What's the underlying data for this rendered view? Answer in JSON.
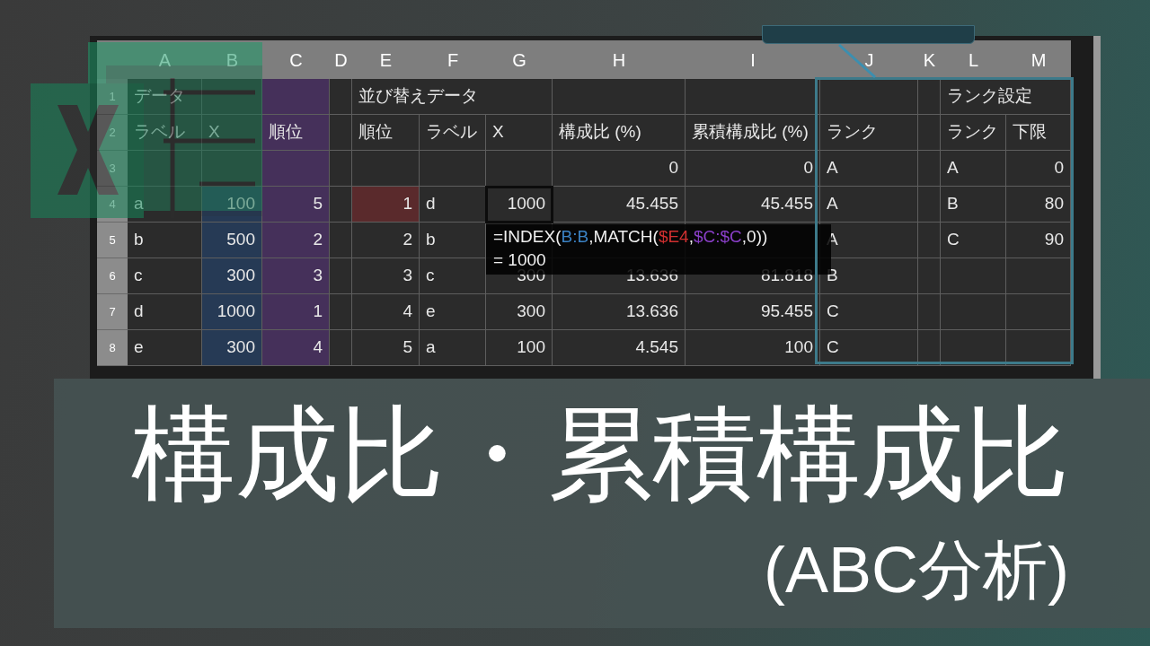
{
  "sheet": {
    "columns": [
      "A",
      "B",
      "C",
      "D",
      "E",
      "F",
      "G",
      "H",
      "I",
      "J",
      "K",
      "L",
      "M"
    ],
    "rows": [
      {
        "header": "1",
        "cells": [
          {
            "kind": "text",
            "text": "データ",
            "selected": false
          },
          {
            "kind": "empty",
            "selected": false
          },
          {
            "kind": "empty",
            "color": "#45305a",
            "selected": false
          },
          {
            "kind": "empty",
            "selected": false
          },
          {
            "kind": "heading",
            "text": "並び替えデータ",
            "selected": false
          },
          {
            "kind": "covered"
          },
          {
            "kind": "covered"
          },
          {
            "kind": "empty",
            "selected": false
          },
          {
            "kind": "empty",
            "selected": false
          },
          {
            "kind": "empty",
            "selected": false
          },
          {
            "kind": "empty",
            "selected": false
          },
          {
            "kind": "heading",
            "text": "ランク設定",
            "selected": false
          },
          {
            "kind": "covered"
          }
        ]
      },
      {
        "header": "2",
        "cells": [
          {
            "kind": "text",
            "text": "ラベル",
            "selected": false
          },
          {
            "kind": "text",
            "text": "X",
            "selected": false
          },
          {
            "kind": "text",
            "text": "順位",
            "color": "#45305a",
            "selected": false
          },
          {
            "kind": "empty",
            "selected": false
          },
          {
            "kind": "text",
            "text": "順位",
            "selected": false
          },
          {
            "kind": "text",
            "text": "ラベル",
            "selected": false
          },
          {
            "kind": "text",
            "text": "X",
            "selected": false
          },
          {
            "kind": "text",
            "text": "構成比 (%)",
            "selected": false
          },
          {
            "kind": "text",
            "text": "累積構成比 (%)",
            "selected": false
          },
          {
            "kind": "text",
            "text": "ランク",
            "selected": false
          },
          {
            "kind": "empty",
            "selected": false
          },
          {
            "kind": "text",
            "text": "ランク",
            "selected": false
          },
          {
            "kind": "text",
            "text": "下限",
            "selected": false
          }
        ]
      },
      {
        "header": "3",
        "cells": [
          {
            "kind": "empty",
            "selected": false
          },
          {
            "kind": "empty",
            "selected": false
          },
          {
            "kind": "empty",
            "color": "#45305a",
            "selected": false
          },
          {
            "kind": "empty",
            "selected": false
          },
          {
            "kind": "empty",
            "selected": false
          },
          {
            "kind": "empty",
            "selected": false
          },
          {
            "kind": "empty",
            "selected": false
          },
          {
            "kind": "number",
            "text": "0",
            "selected": false
          },
          {
            "kind": "number",
            "text": "0",
            "selected": false
          },
          {
            "kind": "text",
            "text": "A",
            "selected": false
          },
          {
            "kind": "empty",
            "selected": false
          },
          {
            "kind": "text",
            "text": "A",
            "selected": false
          },
          {
            "kind": "number",
            "text": "0",
            "selected": false
          }
        ]
      },
      {
        "header": "4",
        "cells": [
          {
            "kind": "text",
            "text": "a",
            "selected": false
          },
          {
            "kind": "number",
            "text": "100",
            "color": "#263a55",
            "selected": false
          },
          {
            "kind": "number",
            "text": "5",
            "color": "#45305a",
            "selected": false
          },
          {
            "kind": "empty",
            "selected": false
          },
          {
            "kind": "number",
            "text": "1",
            "color": "#5a2a2c",
            "selected": false
          },
          {
            "kind": "text",
            "text": "d",
            "selected": false
          },
          {
            "kind": "number",
            "text": "1000",
            "selected": true
          },
          {
            "kind": "number",
            "text": "45.455",
            "selected": false
          },
          {
            "kind": "number",
            "text": "45.455",
            "selected": false
          },
          {
            "kind": "text",
            "text": "A",
            "selected": false
          },
          {
            "kind": "empty",
            "selected": false
          },
          {
            "kind": "text",
            "text": "B",
            "selected": false
          },
          {
            "kind": "number",
            "text": "80",
            "selected": false
          }
        ]
      },
      {
        "header": "5",
        "cells": [
          {
            "kind": "text",
            "text": "b",
            "selected": false
          },
          {
            "kind": "number",
            "text": "500",
            "color": "#263a55",
            "selected": false
          },
          {
            "kind": "number",
            "text": "2",
            "color": "#45305a",
            "selected": false
          },
          {
            "kind": "empty",
            "selected": false
          },
          {
            "kind": "number",
            "text": "2",
            "selected": false
          },
          {
            "kind": "text",
            "text": "b",
            "selected": false
          },
          {
            "kind": "hidden"
          },
          {
            "kind": "hidden"
          },
          {
            "kind": "hidden"
          },
          {
            "kind": "text",
            "text": "A",
            "selected": false
          },
          {
            "kind": "empty",
            "selected": false
          },
          {
            "kind": "text",
            "text": "C",
            "selected": false
          },
          {
            "kind": "number",
            "text": "90",
            "selected": false
          }
        ]
      },
      {
        "header": "6",
        "cells": [
          {
            "kind": "text",
            "text": "c",
            "selected": false
          },
          {
            "kind": "number",
            "text": "300",
            "color": "#263a55",
            "selected": false
          },
          {
            "kind": "number",
            "text": "3",
            "color": "#45305a",
            "selected": false
          },
          {
            "kind": "empty",
            "selected": false
          },
          {
            "kind": "number",
            "text": "3",
            "selected": false
          },
          {
            "kind": "text",
            "text": "c",
            "selected": false
          },
          {
            "kind": "number",
            "text": "300",
            "selected": false
          },
          {
            "kind": "number",
            "text": "13.636",
            "selected": false
          },
          {
            "kind": "number",
            "text": "81.818",
            "selected": false
          },
          {
            "kind": "text",
            "text": "B",
            "selected": false
          },
          {
            "kind": "empty",
            "selected": false
          },
          {
            "kind": "empty",
            "selected": false
          },
          {
            "kind": "empty",
            "selected": false
          }
        ]
      },
      {
        "header": "7",
        "cells": [
          {
            "kind": "text",
            "text": "d",
            "selected": false
          },
          {
            "kind": "number",
            "text": "1000",
            "color": "#263a55",
            "selected": false
          },
          {
            "kind": "number",
            "text": "1",
            "color": "#45305a",
            "selected": false
          },
          {
            "kind": "empty",
            "selected": false
          },
          {
            "kind": "number",
            "text": "4",
            "selected": false
          },
          {
            "kind": "text",
            "text": "e",
            "selected": false
          },
          {
            "kind": "number",
            "text": "300",
            "selected": false
          },
          {
            "kind": "number",
            "text": "13.636",
            "selected": false
          },
          {
            "kind": "number",
            "text": "95.455",
            "selected": false
          },
          {
            "kind": "text",
            "text": "C",
            "selected": false
          },
          {
            "kind": "empty",
            "selected": false
          },
          {
            "kind": "empty",
            "selected": false
          },
          {
            "kind": "empty",
            "selected": false
          }
        ]
      },
      {
        "header": "8",
        "cells": [
          {
            "kind": "text",
            "text": "e",
            "selected": false
          },
          {
            "kind": "number",
            "text": "300",
            "color": "#263a55",
            "selected": false
          },
          {
            "kind": "number",
            "text": "4",
            "color": "#45305a",
            "selected": false
          },
          {
            "kind": "empty",
            "selected": false
          },
          {
            "kind": "number",
            "text": "5",
            "selected": false
          },
          {
            "kind": "text",
            "text": "a",
            "selected": false
          },
          {
            "kind": "number",
            "text": "100",
            "selected": false
          },
          {
            "kind": "number",
            "text": "4.545",
            "selected": false
          },
          {
            "kind": "number",
            "text": "100",
            "selected": false
          },
          {
            "kind": "text",
            "text": "C",
            "selected": false
          },
          {
            "kind": "empty",
            "selected": false
          },
          {
            "kind": "empty",
            "selected": false
          },
          {
            "kind": "empty",
            "selected": false
          }
        ]
      }
    ],
    "formula_tooltip": {
      "formula_parts": [
        {
          "text": "=INDEX(",
          "color": "#f0f0f0"
        },
        {
          "text": "B:B",
          "color": "#3b82c4"
        },
        {
          "text": ",MATCH(",
          "color": "#f0f0f0"
        },
        {
          "text": "$E4",
          "color": "#d03030"
        },
        {
          "text": ",",
          "color": "#f0f0f0"
        },
        {
          "text": "$C:$C",
          "color": "#8a3fc8"
        },
        {
          "text": ",0))",
          "color": "#f0f0f0"
        }
      ],
      "result": "= 1000"
    }
  },
  "title": "構成比・累積構成比",
  "subtitle": "(ABC分析)"
}
